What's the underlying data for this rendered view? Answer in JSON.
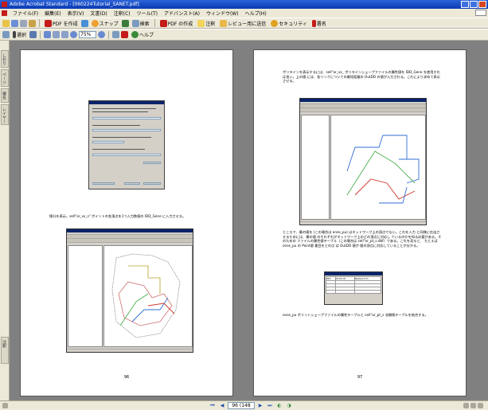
{
  "window": {
    "title": "Adobe Acrobat Standard - [060224Tutorial_SANET.pdf]"
  },
  "menu": [
    "ファイル(F)",
    "編集(E)",
    "表示(V)",
    "文書(D)",
    "注釈(C)",
    "ツール(T)",
    "アドバンスト(A)",
    "ウィンドウ(W)",
    "ヘルプ(H)"
  ],
  "toolbar1": {
    "pdf_create": "PDF を作成",
    "snapshot": "スナップ",
    "search": "検索",
    "pdf_from": "PDF の作成",
    "comment": "注釈",
    "review": "レビュー用に送信",
    "security": "セキュリティ",
    "sign": "署名"
  },
  "toolbar2": {
    "select": "選択",
    "zoom": "75%",
    "help": "ヘルプ"
  },
  "nav_tabs": [
    "しおり",
    "ページ",
    "署名",
    "レイヤー",
    "注釈"
  ],
  "pages": {
    "left_number": "96",
    "right_number": "97",
    "left_paragraph": "線分を表示。sell\"ar_vx_s\" ポイントの各頂点を1つ入力数値の IDD_Gene に入力させる。",
    "right_paragraph_top": "ポリラインを表示するには、sell\"ar_vx_ ポリラインシェープファイルの属性値を IDD_Gene を使用すれば良い。上の値 には、各リンクについての最短距離の OutDD の値が入力される。これにより求めて表示させる。",
    "right_paragraph_mid": "ところで、最の値を (この場合は ones_pu) はネットワーク上の頂点でない。これを入力 と同様に在出させるためには、最の値 のそれぞれがネットワーク上のどの頂点に対応し ているのかを知る必要がある。そのための ファイルの属性値テーブル（この場合は sell\"ar_pt_s.dbf）である。これを見ると、 たとえば ones_pu の Point値 番目をとの点 は OutDD 値が 値の頂点に対応していることが分かる。",
    "right_paragraph_bottom": "ones_pu ポイントシェープファイルの属性テーブルと sell\"ar_pt_s 非類線テーブルを結合する。"
  },
  "attr_table": {
    "cols": [
      "OID",
      "Point ID",
      "Network ID"
    ]
  },
  "status": {
    "page": "96 (148",
    "total": "/ 148"
  },
  "colors": {
    "title_bar": "#0a3ab3",
    "doc_bg": "#808080",
    "route_green": "#4caf50",
    "route_blue": "#2f6fd6",
    "route_red": "#d0342c"
  }
}
